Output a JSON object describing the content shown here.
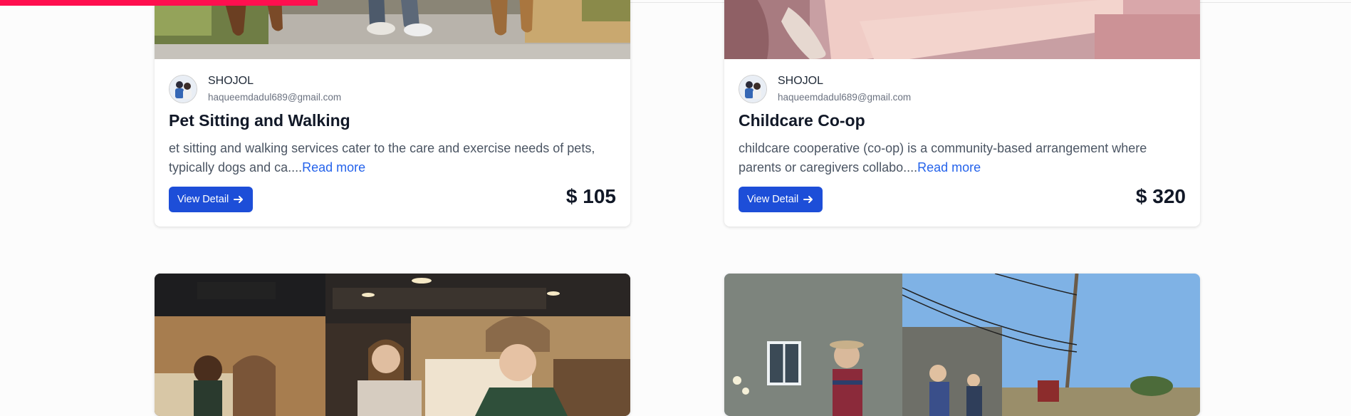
{
  "progress": 0.235,
  "cards_top": [
    {
      "author_name": "SHOJOL",
      "author_email": "haqueemdadul689@gmail.com",
      "title": "Pet Sitting and Walking",
      "description": "et sitting and walking services cater to the care and exercise needs of pets, typically dogs and ca....",
      "read_more": "Read more",
      "button_label": "View Detail",
      "price": "$ 105"
    },
    {
      "author_name": "SHOJOL",
      "author_email": "haqueemdadul689@gmail.com",
      "title": "Childcare Co-op",
      "description": "childcare cooperative (co-op) is a community-based arrangement where parents or caregivers collabo....",
      "read_more": "Read more",
      "button_label": "View Detail",
      "price": "$ 320"
    }
  ],
  "colors": {
    "accent": "#1d4ed8",
    "link": "#2563eb",
    "progress": "#ff0f4f"
  },
  "icons": {
    "button": "arrow-right-icon"
  }
}
